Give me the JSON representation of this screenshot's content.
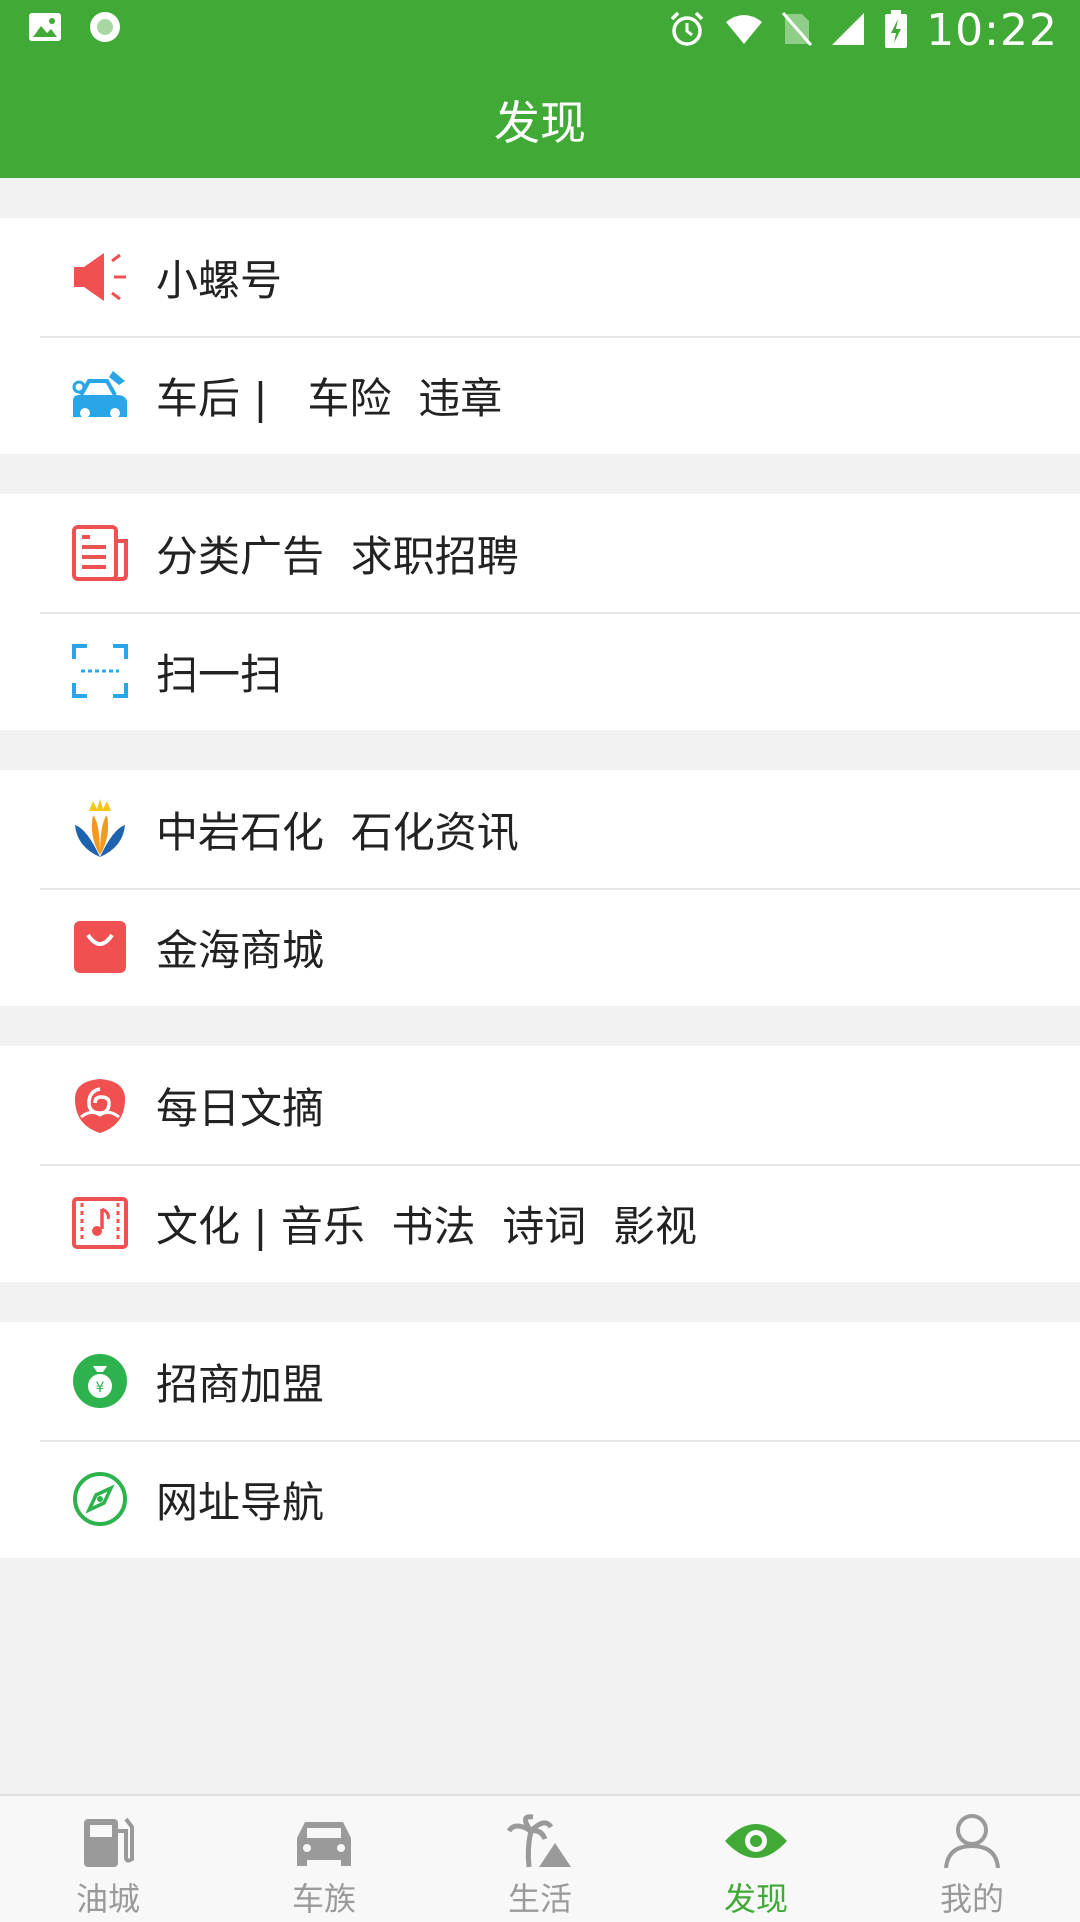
{
  "status_bar": {
    "time": "10:22"
  },
  "header": {
    "title": "发现"
  },
  "groups": [
    {
      "items": [
        {
          "label": "小螺号",
          "icon": "megaphone-icon"
        },
        {
          "label": "车后 |   车险  违章",
          "icon": "car-service-icon"
        }
      ]
    },
    {
      "items": [
        {
          "label": "分类广告  求职招聘",
          "icon": "document-list-icon"
        },
        {
          "label": "扫一扫",
          "icon": "scan-icon"
        }
      ]
    },
    {
      "items": [
        {
          "label": "中岩石化  石化资讯",
          "icon": "petrochem-logo-icon"
        },
        {
          "label": "金海商城",
          "icon": "shopping-bag-icon"
        }
      ]
    },
    {
      "items": [
        {
          "label": "每日文摘",
          "icon": "rose-icon"
        },
        {
          "label": "文化 | 音乐  书法  诗词  影视",
          "icon": "music-film-icon"
        }
      ]
    },
    {
      "items": [
        {
          "label": "招商加盟",
          "icon": "money-bag-icon"
        },
        {
          "label": "网址导航",
          "icon": "compass-icon"
        }
      ]
    }
  ],
  "tabs": [
    {
      "label": "油城",
      "icon": "fuel-pump-icon",
      "active": false
    },
    {
      "label": "车族",
      "icon": "car-icon",
      "active": false
    },
    {
      "label": "生活",
      "icon": "palm-tree-icon",
      "active": false
    },
    {
      "label": "发现",
      "icon": "eye-icon",
      "active": true
    },
    {
      "label": "我的",
      "icon": "person-icon",
      "active": false
    }
  ],
  "colors": {
    "brand_green": "#41aa37",
    "icon_red": "#f0504f",
    "icon_blue": "#2aa6e8",
    "tab_inactive": "#9a9a9a"
  }
}
